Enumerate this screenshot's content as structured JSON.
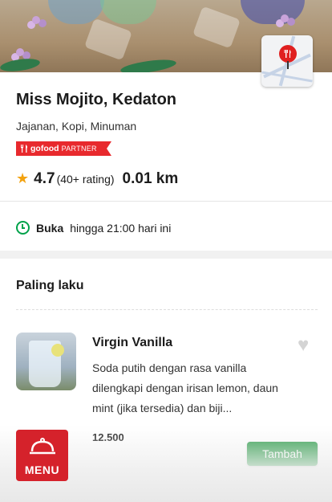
{
  "restaurant": {
    "name": "Miss Mojito, Kedaton",
    "categories": "Jajanan, Kopi, Minuman",
    "badge_brand": "gofood",
    "badge_partner": "PARTNER",
    "rating": "4.7",
    "rating_count": "(40+ rating)",
    "distance": "0.01 km",
    "status": "Buka",
    "hours": "hingga 21:00 hari ini"
  },
  "section": {
    "title": "Paling laku",
    "items": [
      {
        "name": "Virgin Vanilla",
        "description": "Soda putih dengan rasa vanilla dilengkapi dengan irisan lemon, daun mint (jika tersedia) dan biji...",
        "price": "12.500",
        "add_label": "Tambah"
      }
    ]
  },
  "menu_button": {
    "label": "MENU"
  },
  "colors": {
    "brand_red": "#e8292d",
    "accent_green": "#2a9b48",
    "star": "#f3a20f",
    "open_green": "#00a24a"
  },
  "icons": [
    "map-pin-icon",
    "gofood-cutlery-icon",
    "star-icon",
    "clock-icon",
    "heart-icon",
    "cloche-icon"
  ]
}
